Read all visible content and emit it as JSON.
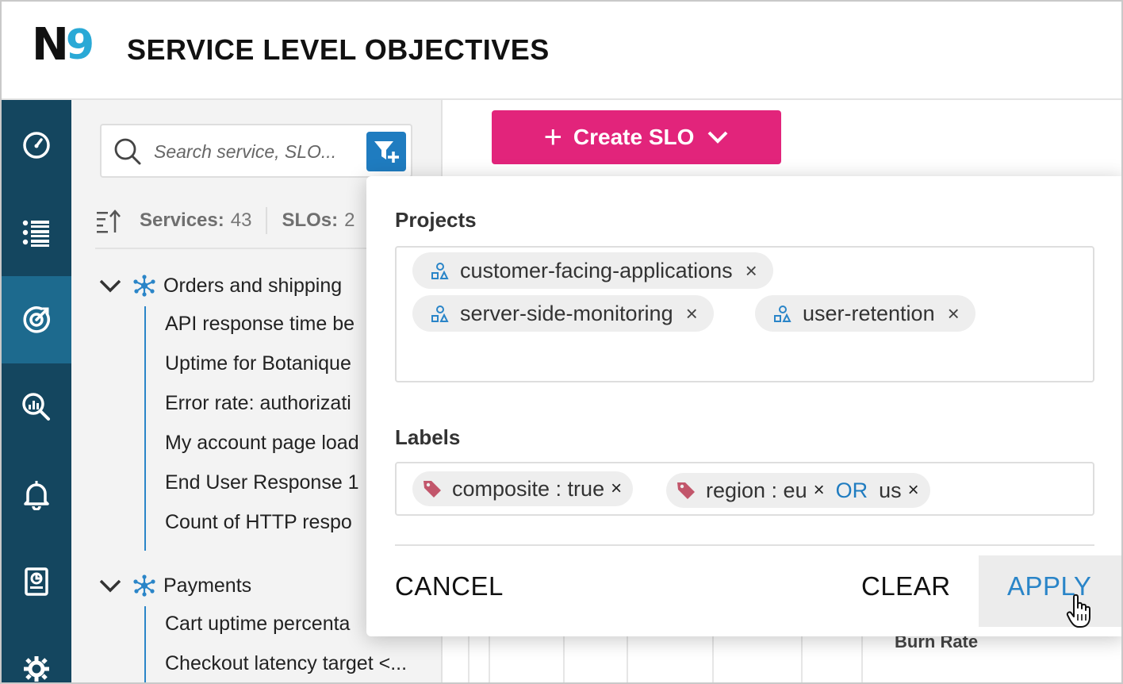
{
  "header": {
    "logo_letter": "N",
    "logo_digit": "9",
    "title": "SERVICE LEVEL OBJECTIVES",
    "accent_color": "#2aa9d6"
  },
  "sidebar": {
    "items": [
      {
        "icon": "speedometer-icon"
      },
      {
        "icon": "list-icon"
      },
      {
        "icon": "target-icon",
        "active": true
      },
      {
        "icon": "analytics-search-icon"
      },
      {
        "icon": "bell-icon"
      },
      {
        "icon": "report-icon"
      },
      {
        "icon": "gear-icon"
      }
    ],
    "bg_color": "#14465f",
    "active_color": "#1d6a8e"
  },
  "search": {
    "placeholder": "Search service, SLO..."
  },
  "stats": {
    "services_label": "Services:",
    "services_count": "43",
    "slos_label": "SLOs:",
    "slos_count": "2"
  },
  "tree": [
    {
      "name": "Orders and shipping",
      "items": [
        "API response time be",
        "Uptime for Botanique",
        "Error rate: authorizati",
        "My account page load",
        "End User Response 1",
        "Count of HTTP respo"
      ]
    },
    {
      "name": "Payments",
      "items": [
        "Cart uptime percenta",
        "Checkout latency target <..."
      ]
    }
  ],
  "main": {
    "create_button": {
      "plus": "+",
      "label": "Create SLO",
      "color": "#e2247b"
    },
    "burn_rate_label": "Burn Rate"
  },
  "filter_modal": {
    "projects_title": "Projects",
    "projects": [
      {
        "name": "customer-facing-applications",
        "remove": "×"
      },
      {
        "name": "server-side-monitoring",
        "remove": "×"
      },
      {
        "name": "user-retention",
        "remove": "×"
      }
    ],
    "labels_title": "Labels",
    "labels": [
      {
        "text": "composite : true",
        "remove": "×"
      },
      {
        "key": "region : eu",
        "remove1": "×",
        "or": "OR",
        "value2": "us",
        "remove2": "×"
      }
    ],
    "cancel_label": "CANCEL",
    "clear_label": "CLEAR",
    "apply_label": "APPLY",
    "link_color": "#2a85c8"
  }
}
